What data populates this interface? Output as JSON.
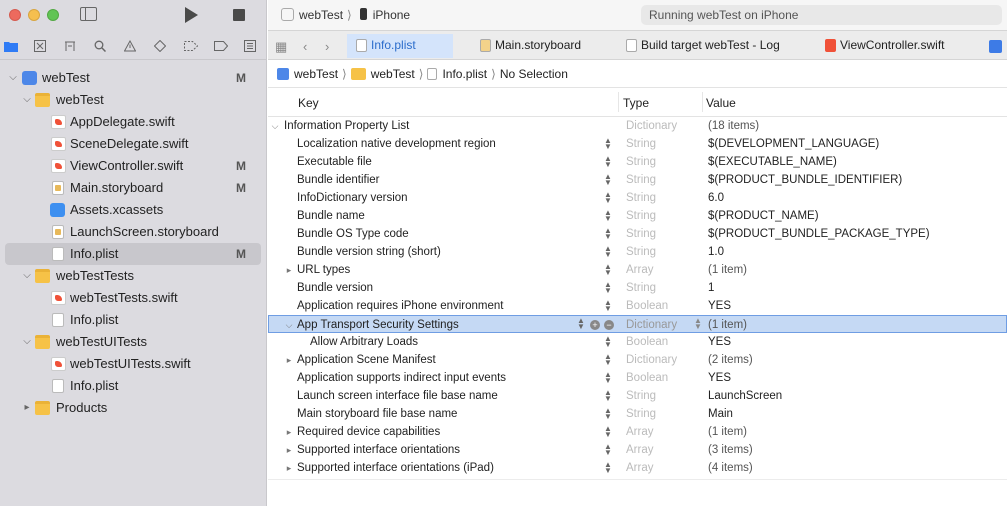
{
  "toolbar": {
    "scheme": "webTest",
    "device": "iPhone",
    "status": "Running webTest on iPhone"
  },
  "tabs": [
    {
      "label": "Info.plist",
      "active": true
    },
    {
      "label": "Main.storyboard",
      "active": false
    },
    {
      "label": "Build target webTest - Log",
      "active": false
    },
    {
      "label": "ViewController.swift",
      "active": false
    }
  ],
  "jumpbar": {
    "project": "webTest",
    "group": "webTest",
    "file": "Info.plist",
    "selection": "No Selection"
  },
  "navigator": {
    "items": [
      {
        "label": "webTest",
        "badge": "M"
      },
      {
        "label": "webTest"
      },
      {
        "label": "AppDelegate.swift"
      },
      {
        "label": "SceneDelegate.swift"
      },
      {
        "label": "ViewController.swift",
        "badge": "M"
      },
      {
        "label": "Main.storyboard",
        "badge": "M"
      },
      {
        "label": "Assets.xcassets"
      },
      {
        "label": "LaunchScreen.storyboard"
      },
      {
        "label": "Info.plist",
        "badge": "M"
      },
      {
        "label": "webTestTests"
      },
      {
        "label": "webTestTests.swift"
      },
      {
        "label": "Info.plist"
      },
      {
        "label": "webTestUITests"
      },
      {
        "label": "webTestUITests.swift"
      },
      {
        "label": "Info.plist"
      },
      {
        "label": "Products"
      }
    ]
  },
  "plist": {
    "headers": {
      "key": "Key",
      "type": "Type",
      "value": "Value"
    },
    "rows": [
      {
        "key": "Information Property List",
        "type": "Dictionary",
        "value": "(18 items)"
      },
      {
        "key": "Localization native development region",
        "type": "String",
        "value": "$(DEVELOPMENT_LANGUAGE)"
      },
      {
        "key": "Executable file",
        "type": "String",
        "value": "$(EXECUTABLE_NAME)"
      },
      {
        "key": "Bundle identifier",
        "type": "String",
        "value": "$(PRODUCT_BUNDLE_IDENTIFIER)"
      },
      {
        "key": "InfoDictionary version",
        "type": "String",
        "value": "6.0"
      },
      {
        "key": "Bundle name",
        "type": "String",
        "value": "$(PRODUCT_NAME)"
      },
      {
        "key": "Bundle OS Type code",
        "type": "String",
        "value": "$(PRODUCT_BUNDLE_PACKAGE_TYPE)"
      },
      {
        "key": "Bundle version string (short)",
        "type": "String",
        "value": "1.0"
      },
      {
        "key": "URL types",
        "type": "Array",
        "value": "(1 item)"
      },
      {
        "key": "Bundle version",
        "type": "String",
        "value": "1"
      },
      {
        "key": "Application requires iPhone environment",
        "type": "Boolean",
        "value": "YES"
      },
      {
        "key": "App Transport Security Settings",
        "type": "Dictionary",
        "value": "(1 item)"
      },
      {
        "key": "Allow Arbitrary Loads",
        "type": "Boolean",
        "value": "YES"
      },
      {
        "key": "Application Scene Manifest",
        "type": "Dictionary",
        "value": "(2 items)"
      },
      {
        "key": "Application supports indirect input events",
        "type": "Boolean",
        "value": "YES"
      },
      {
        "key": "Launch screen interface file base name",
        "type": "String",
        "value": "LaunchScreen"
      },
      {
        "key": "Main storyboard file base name",
        "type": "String",
        "value": "Main"
      },
      {
        "key": "Required device capabilities",
        "type": "Array",
        "value": "(1 item)"
      },
      {
        "key": "Supported interface orientations",
        "type": "Array",
        "value": "(3 items)"
      },
      {
        "key": "Supported interface orientations (iPad)",
        "type": "Array",
        "value": "(4 items)"
      }
    ]
  }
}
